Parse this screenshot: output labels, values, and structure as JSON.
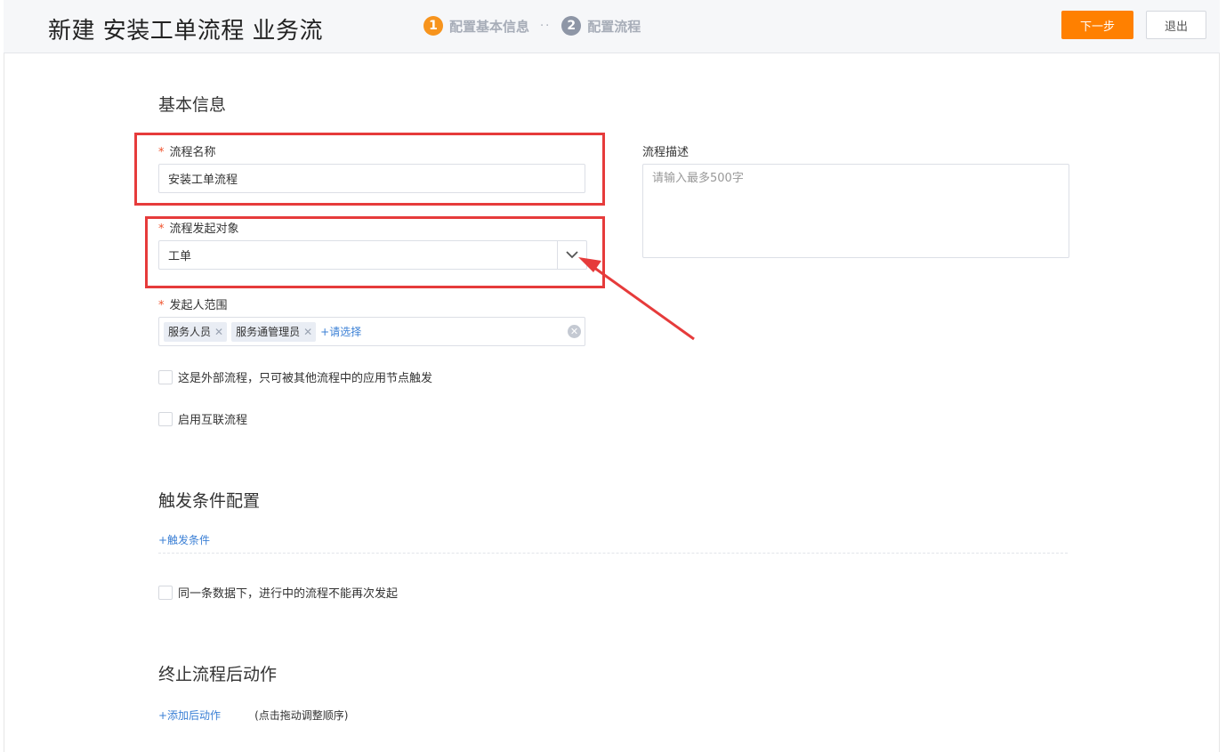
{
  "header": {
    "title": "新建 安装工单流程 业务流",
    "steps": [
      {
        "num": "1",
        "label": "配置基本信息",
        "active": true
      },
      {
        "num": "2",
        "label": "配置流程",
        "active": false
      }
    ],
    "step_separator": "··",
    "next_button": "下一步",
    "exit_button": "退出"
  },
  "basic_info": {
    "section_title": "基本信息",
    "required_mark": "*",
    "flow_name": {
      "label": "流程名称",
      "value": "安装工单流程"
    },
    "flow_description": {
      "label": "流程描述",
      "placeholder": "请输入最多500字"
    },
    "initiator_object": {
      "label": "流程发起对象",
      "value": "工单"
    },
    "initiator_scope": {
      "label": "发起人范围",
      "tags": [
        "服务人员",
        "服务通管理员"
      ],
      "add_label": "+请选择"
    },
    "checkbox_external": "这是外部流程，只可被其他流程中的应用节点触发",
    "checkbox_interconnect": "启用互联流程"
  },
  "trigger": {
    "section_title": "触发条件配置",
    "add_label": "+触发条件",
    "checkbox_no_repeat": "同一条数据下，进行中的流程不能再次发起"
  },
  "after_actions": {
    "section_title": "终止流程后动作",
    "add_label": "+添加后动作",
    "hint": "(点击拖动调整顺序)"
  },
  "colors": {
    "accent": "#ff8000",
    "step_active": "#f7941d",
    "step_inactive": "#8e96a6",
    "link": "#3a7fd5",
    "annotation_red": "#e63b3b"
  }
}
